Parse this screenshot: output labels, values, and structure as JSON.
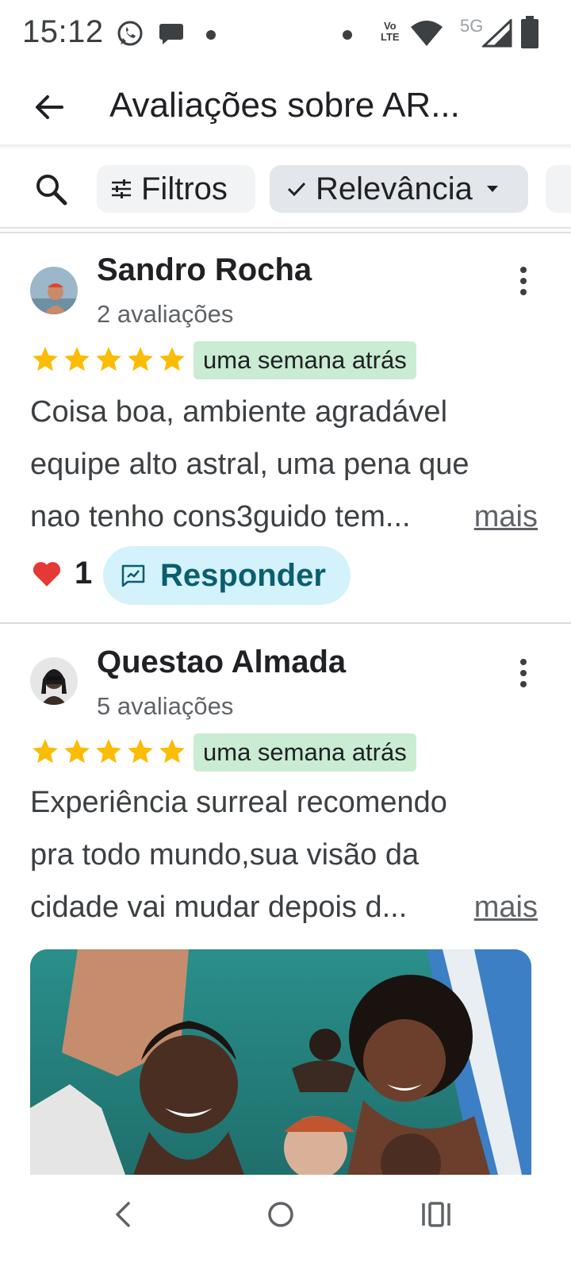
{
  "status_bar": {
    "time": "15:12",
    "icons": [
      "whatsapp-icon",
      "chat-bubble-icon",
      "dot-icon",
      "dot-icon",
      "volte-icon",
      "wifi-icon",
      "signal-icon",
      "battery-icon"
    ],
    "volte_top": "Vo",
    "volte_bottom": "LTE",
    "network": "5G"
  },
  "app_bar": {
    "title": "Avaliações sobre AR..."
  },
  "chips": {
    "filters_label": "Filtros",
    "sort_label": "Relevância"
  },
  "reviews": [
    {
      "name": "Sandro Rocha",
      "count": "2 avaliações",
      "rating": 5,
      "when": "uma semana atrás",
      "text_lines": [
        "Coisa boa, ambiente agradável",
        "equipe alto astral, uma pena que",
        "nao tenho cons3guido tem..."
      ],
      "more_label": "mais",
      "reactions": "1",
      "reply_label": "Responder"
    },
    {
      "name": "Questao Almada",
      "count": "5 avaliações",
      "rating": 5,
      "when": "uma semana atrás",
      "text_lines": [
        "Experiência surreal recomendo",
        "pra todo mundo,sua visão da",
        "cidade vai mudar depois d..."
      ],
      "more_label": "mais"
    }
  ],
  "colors": {
    "star": "#fbbc04",
    "time_badge": "#c9ecd2",
    "reply_bg": "#d3f2fb",
    "reply_text": "#0b5e6e",
    "heart": "#e53935"
  }
}
